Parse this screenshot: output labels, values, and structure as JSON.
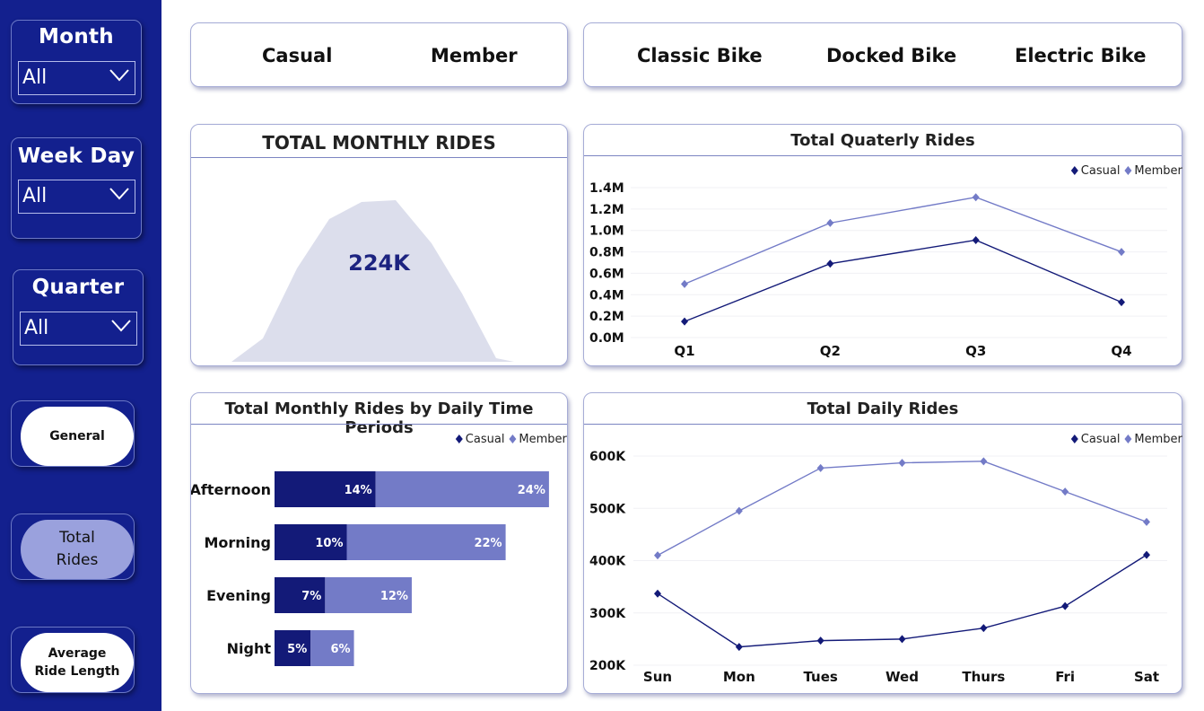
{
  "sidebar": {
    "slicers": [
      {
        "title": "Month",
        "value": "All"
      },
      {
        "title": "Week Day",
        "value": "All"
      },
      {
        "title": "Quarter",
        "value": "All"
      }
    ],
    "nav": [
      {
        "label": "General"
      },
      {
        "label_line1": "Total",
        "label_line2": "Rides"
      },
      {
        "label_line1": "Average",
        "label_line2": "Ride Length"
      }
    ]
  },
  "filters": {
    "rider_types": [
      "Casual",
      "Member"
    ],
    "bike_types": [
      "Classic Bike",
      "Docked Bike",
      "Electric Bike"
    ]
  },
  "colors": {
    "casual": "#131a78",
    "member": "#737bc7",
    "area": "#dcdeec",
    "sidebar": "#13208e"
  },
  "monthly_card": {
    "title": "TOTAL MONTHLY RIDES",
    "value": "224K"
  },
  "quarterly_card": {
    "title": "Total Quaterly Rides",
    "chart_data": {
      "type": "line",
      "categories": [
        "Q1",
        "Q2",
        "Q3",
        "Q4"
      ],
      "series": [
        {
          "name": "Casual",
          "values": [
            0.15,
            0.69,
            0.91,
            0.33
          ]
        },
        {
          "name": "Member",
          "values": [
            0.5,
            1.07,
            1.31,
            0.8
          ]
        }
      ],
      "yticks": [
        "0.0M",
        "0.2M",
        "0.4M",
        "0.6M",
        "0.8M",
        "1.0M",
        "1.2M",
        "1.4M"
      ],
      "ylim": [
        0,
        1.4
      ]
    }
  },
  "periods_card": {
    "title": "Total Monthly Rides by Daily Time Periods",
    "chart_data": {
      "type": "bar",
      "stacked": true,
      "orientation": "horizontal",
      "categories": [
        "Afternoon",
        "Morning",
        "Evening",
        "Night"
      ],
      "series": [
        {
          "name": "Casual",
          "values": [
            14,
            10,
            7,
            5
          ],
          "labels": [
            "14%",
            "10%",
            "7%",
            "5%"
          ]
        },
        {
          "name": "Member",
          "values": [
            24,
            22,
            12,
            6
          ],
          "labels": [
            "24%",
            "22%",
            "12%",
            "6%"
          ]
        }
      ]
    }
  },
  "daily_card": {
    "title": "Total Daily Rides",
    "chart_data": {
      "type": "line",
      "categories": [
        "Sun",
        "Mon",
        "Tues",
        "Wed",
        "Thurs",
        "Fri",
        "Sat"
      ],
      "series": [
        {
          "name": "Casual",
          "values": [
            337,
            235,
            247,
            250,
            271,
            313,
            411
          ]
        },
        {
          "name": "Member",
          "values": [
            410,
            495,
            577,
            587,
            590,
            532,
            474
          ]
        }
      ],
      "yticks": [
        "200K",
        "300K",
        "400K",
        "500K",
        "600K"
      ],
      "ylim": [
        200,
        600
      ]
    }
  }
}
